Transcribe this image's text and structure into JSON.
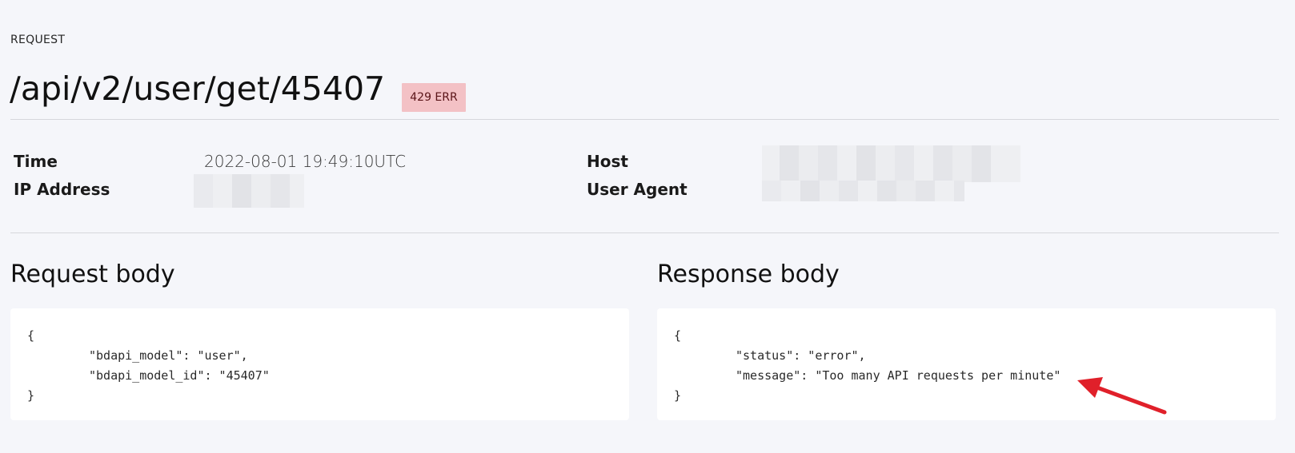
{
  "header": {
    "eyebrow": "REQUEST",
    "endpoint": "/api/v2/user/get/45407",
    "status_badge": "429 ERR"
  },
  "meta": {
    "time_label": "Time",
    "time_value": "2022-08-01 19:49:10UTC",
    "ip_label": "IP Address",
    "host_label": "Host",
    "user_agent_label": "User Agent"
  },
  "request_body": {
    "title": "Request body",
    "lines": [
      "{",
      "\"bdapi_model\": \"user\",",
      "\"bdapi_model_id\": \"45407\"",
      "}"
    ]
  },
  "response_body": {
    "title": "Response body",
    "lines": [
      "{",
      "\"status\": \"error\",",
      "\"message\": \"Too many API requests per minute\"",
      "}"
    ]
  },
  "colors": {
    "background": "#f5f6fa",
    "badge_bg": "#f3c1c5",
    "badge_text": "#5a1418",
    "annotation_arrow": "#e0202a"
  },
  "icons": {
    "annotation": "arrow-annotation-icon"
  }
}
